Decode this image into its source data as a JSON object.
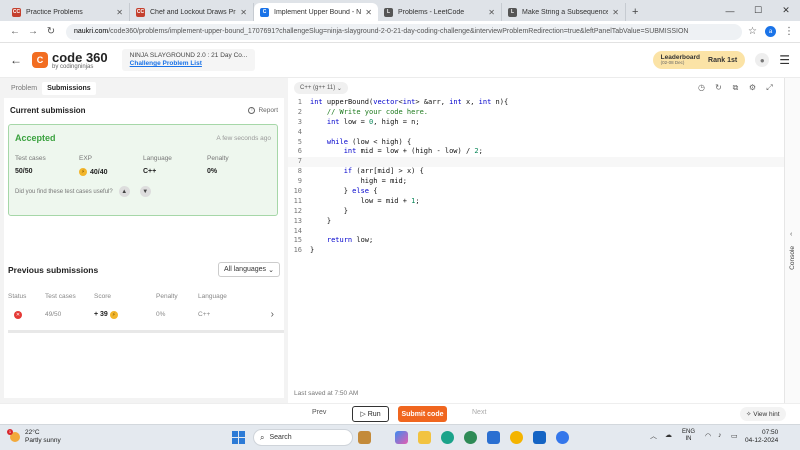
{
  "browser": {
    "tabs": [
      {
        "label": "Practice Problems",
        "fav_color": "#c4402e",
        "fav_text": "CC",
        "active": false
      },
      {
        "label": "Chef and Lockout Draws Practi...",
        "fav_color": "#c4402e",
        "fav_text": "CC",
        "active": false
      },
      {
        "label": "Implement Upper Bound - Nau...",
        "fav_color": "#1a73e8",
        "fav_text": "C",
        "active": true
      },
      {
        "label": "Problems - LeetCode",
        "fav_color": "#555555",
        "fav_text": "L",
        "active": false
      },
      {
        "label": "Make String a Subsequence U...",
        "fav_color": "#555555",
        "fav_text": "L",
        "active": false
      }
    ],
    "new_tab": "+",
    "url_domain": "naukri.com",
    "url_path": "/code360/problems/implement-upper-bound_1707691?challengeSlug=ninja-slayground-2-0-21-day-coding-challenge&interviewProblemRedirection=true&leftPanelTabValue=SUBMISSION",
    "profile_initial": "a"
  },
  "header": {
    "logo_text": "code 360",
    "logo_sub": "by codingninjas",
    "contest_name": "NINJA SLAYGROUND 2.0 : 21 Day Co...",
    "contest_link": "Challenge Problem List",
    "leaderboard_label": "Leaderboard",
    "leaderboard_dates": "(02-08 Dec)",
    "rank_label": "Rank",
    "rank_value": "1st"
  },
  "left_panel": {
    "tabs": [
      {
        "label": "Problem",
        "active": false
      },
      {
        "label": "Submissions",
        "active": true
      }
    ],
    "current_submission_title": "Current submission",
    "report_label": "Report",
    "status": "Accepted",
    "time_ago": "A few seconds ago",
    "stats": [
      {
        "key": "Test cases",
        "value": "50/50"
      },
      {
        "key": "EXP",
        "value": "40/40"
      },
      {
        "key": "Language",
        "value": "C++"
      },
      {
        "key": "Penalty",
        "value": "0%"
      }
    ],
    "useful_question": "Did you find these test cases useful?",
    "previous_title": "Previous submissions",
    "language_filter": "All languages",
    "columns": [
      "Status",
      "Test cases",
      "Score",
      "Penalty",
      "Language"
    ],
    "rows": [
      {
        "test_cases": "49/50",
        "score": "+ 39",
        "penalty": "0%",
        "language": "C++"
      }
    ]
  },
  "editor": {
    "language": "C++ (g++ 11)",
    "last_saved": "Last saved at 7:50 AM",
    "lines": [
      "int upperBound(vector<int> &arr, int x, int n){",
      "    // Write your code here.",
      "    int low = 0, high = n;",
      "",
      "    while (low < high) {",
      "        int mid = low + (high - low) / 2;",
      "        ",
      "        if (arr[mid] > x) {",
      "            high = mid;",
      "        } else {",
      "            low = mid + 1;",
      "        }",
      "    }",
      "",
      "    return low;",
      "}"
    ],
    "current_line": 7
  },
  "actions": {
    "prev": "Prev",
    "run": "Run",
    "submit": "Submit code",
    "next": "Next",
    "hint": "View hint",
    "console": "Console"
  },
  "taskbar": {
    "temperature": "22°C",
    "weather": "Partly sunny",
    "search_placeholder": "Search",
    "lang_top": "ENG",
    "lang_bottom": "IN",
    "time": "07:50",
    "date": "04-12-2024"
  }
}
